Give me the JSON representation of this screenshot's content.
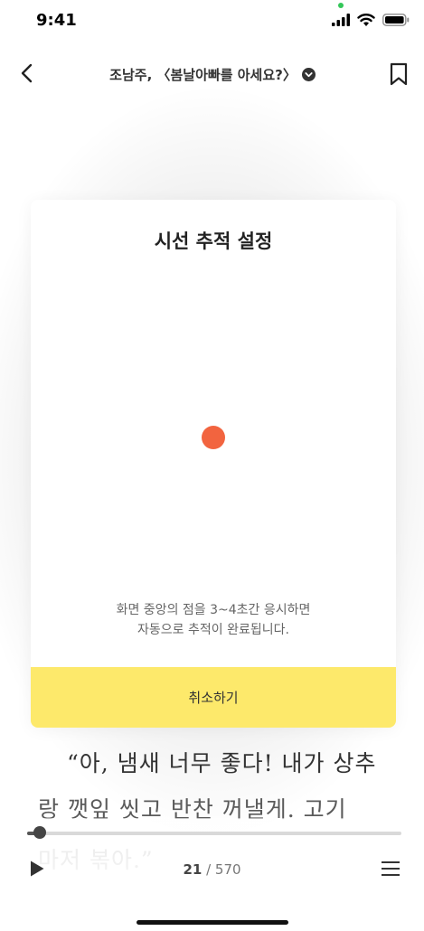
{
  "status_bar": {
    "time": "9:41",
    "icons": [
      "signal-icon",
      "wifi-icon",
      "battery-icon"
    ]
  },
  "nav": {
    "back_icon": "chevron-left-icon",
    "title": "조남주, 〈봄날아빠를 아세요?〉",
    "title_dropdown_icon": "chevron-down-circle-icon",
    "bookmark_icon": "bookmark-icon"
  },
  "dialog": {
    "title": "시선 추적 설정",
    "target_dot_color": "#f2643f",
    "description_line1": "화면 중앙의 점을 3~4초간 응시하면",
    "description_line2": "자동으로 추적이 완료됩니다.",
    "cancel_label": "취소하기",
    "cancel_color": "#fde96b"
  },
  "reader": {
    "line1": "“아, 냄새 너무 좋다! 내가 상추",
    "line2": "랑 깻잎 씻고 반찬 꺼낼게. 고기",
    "line3": "마저 볶아.”"
  },
  "footer": {
    "progress": 0.035,
    "page_current": "21",
    "page_separator": " / ",
    "page_total": "570",
    "play_icon": "play-icon",
    "menu_icon": "menu-icon"
  }
}
